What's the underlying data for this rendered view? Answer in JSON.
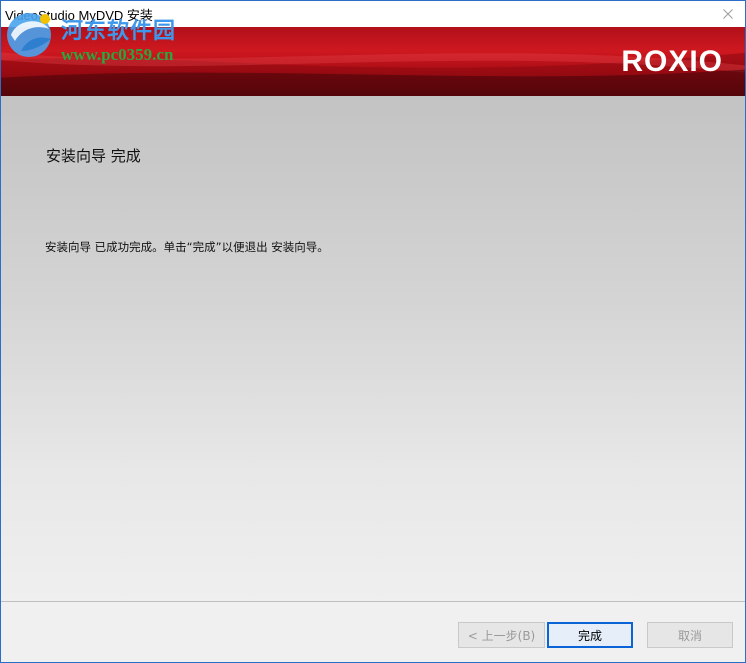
{
  "window": {
    "title": "VideoStudio MyDVD 安装"
  },
  "banner": {
    "logo_text": "ROXIO",
    "watermark_name": "河东软件园",
    "watermark_url": "www.pc0359.cn"
  },
  "wizard": {
    "heading": "安装向导 完成",
    "message": "安装向导 已成功完成。单击“完成”以便退出 安装向导。"
  },
  "buttons": {
    "back_label": "< 上一步(B)",
    "finish_label": "完成",
    "cancel_label": "取消"
  },
  "colors": {
    "banner_red": "#cf1820",
    "banner_dark": "#4a0509",
    "focus_border": "#0a64d8",
    "watermark_blue": "#3d97ea",
    "watermark_green": "#29a83c"
  },
  "icons": {
    "close": "close-icon",
    "watermark_logo": "watermark-logo-icon"
  }
}
